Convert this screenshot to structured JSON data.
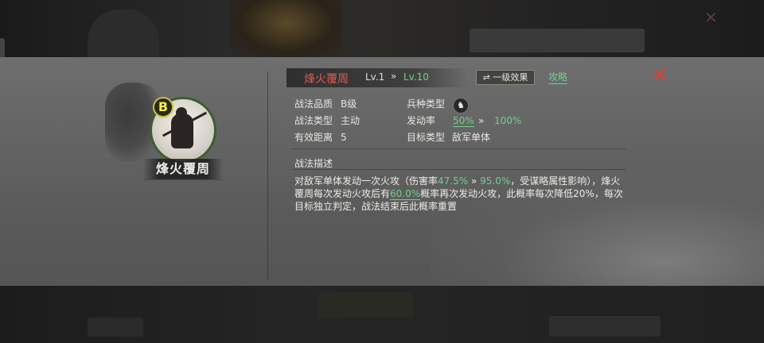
{
  "skill": {
    "grade_letter": "B",
    "name": "烽火覆周",
    "portrait_name": "烽火覆周",
    "level_current": "Lv.1",
    "level_arrow": "»",
    "level_max": "Lv.10",
    "effect_button": "⇌ 一级效果",
    "guide_link": "攻略",
    "close_symbol": "✕"
  },
  "attributes": {
    "quality_label": "战法品质",
    "quality_value": "B级",
    "type_label": "战法类型",
    "type_value": "主动",
    "range_label": "有效距离",
    "range_value": "5",
    "troop_label": "兵种类型",
    "troop_icon": "horse-icon",
    "trigger_label": "发动率",
    "trigger_current": "50%",
    "trigger_arrow": "»",
    "trigger_max": "100%",
    "target_label": "目标类型",
    "target_value": "敌军单体"
  },
  "description": {
    "title": "战法描述",
    "part1": "对敌军单体发动一次火攻（伤害率",
    "dmg_current": "47.5%",
    "arrow": " » ",
    "dmg_max": "95.0%",
    "part2": "，受谋略属性影响），烽火覆周每次发动火攻后有",
    "chance": "60.0%",
    "part3": "概率再次发动火攻，此概率每次降低20%，每次目标独立判定，战法结束后此概率重置"
  },
  "colors": {
    "skill_name": "#e05a52",
    "accent_green": "#6fd08a",
    "close_red": "#d9433a",
    "grade_yellow": "#f2ec5a"
  }
}
